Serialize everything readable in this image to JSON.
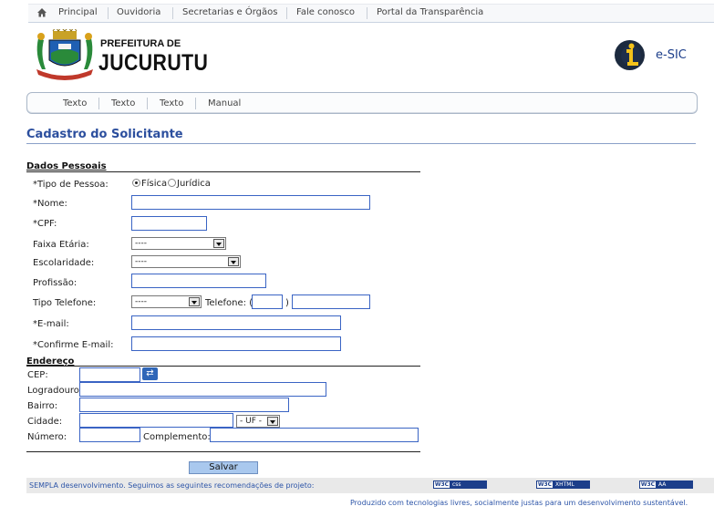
{
  "topnav": {
    "items": [
      "Principal",
      "Ouvidoria",
      "Secretarias e Órgãos",
      "Fale conosco",
      "Portal da Transparência"
    ]
  },
  "header": {
    "logo_line1": "PREFEITURA DE",
    "logo_line2": "JUCURUTU",
    "esic_label": "e-SIC"
  },
  "subnav": {
    "items": [
      "Texto",
      "Texto",
      "Texto",
      "Manual"
    ]
  },
  "page_title": "Cadastro do Solicitante",
  "dados_pessoais": {
    "title": "Dados Pessoais",
    "tipo_pessoa_label": "*Tipo de Pessoa:",
    "tipo_pessoa_options": [
      "Física",
      "Jurídica"
    ],
    "tipo_pessoa_selected": "Física",
    "nome_label": "*Nome:",
    "cpf_label": "*CPF:",
    "faixa_etaria_label": "Faixa Etária:",
    "faixa_etaria_value": "----",
    "escolaridade_label": "Escolaridade:",
    "escolaridade_value": "----",
    "profissao_label": "Profissão:",
    "tipo_telefone_label": "Tipo Telefone:",
    "tipo_telefone_value": "----",
    "telefone_label": "Telefone: (",
    "telefone_close_paren": ")",
    "email_label": "*E-mail:",
    "confirme_email_label": "*Confirme E-mail:"
  },
  "endereco": {
    "title": "Endereço",
    "cep_label": "CEP:",
    "logradouro_label": "Logradouro:",
    "bairro_label": "Bairro:",
    "cidade_label": "Cidade:",
    "uf_value": "- UF -",
    "numero_label": "Número:",
    "complemento_label": "Complemento:"
  },
  "save_label": "Salvar",
  "footer": {
    "text": "SEMPLA desenvolvimento. Seguimos as seguintes recomendações de projeto:",
    "badges": [
      {
        "tag": "W3C",
        "text": "css"
      },
      {
        "tag": "W3C",
        "text": "XHTML"
      },
      {
        "tag": "W3C",
        "text": "AA"
      }
    ],
    "credits": "Produzido com tecnologias livres, socialmente justas para um desenvolvimento sustentável."
  },
  "colors": {
    "title_blue": "#2c4f9e",
    "input_border": "#3a64c4",
    "save_button": "#a9c8ee",
    "footer_bar": "#e9e9e9"
  }
}
